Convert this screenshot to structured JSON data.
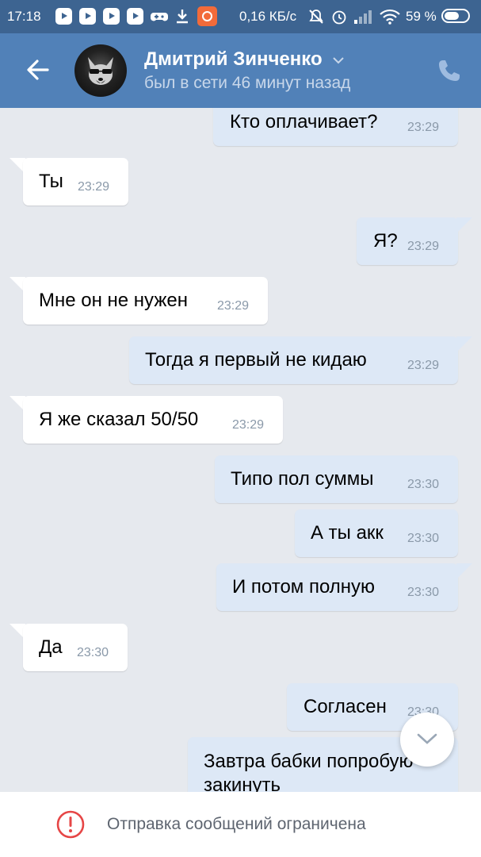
{
  "status_bar": {
    "time": "17:18",
    "network_speed": "0,16 КБ/с",
    "battery": "59 %",
    "icons": [
      "youtube-icon",
      "youtube-icon",
      "youtube-icon",
      "youtube-icon",
      "gamepad-icon",
      "download-icon",
      "app-notification-icon",
      "mute-icon",
      "alarm-icon",
      "signal-icon",
      "wifi-icon",
      "battery-icon"
    ]
  },
  "header": {
    "contact_name": "Дмитрий Зинченко",
    "last_seen": "был в сети 46 минут назад",
    "colors": {
      "header": "#5181b8",
      "status_bar": "#3d6491"
    }
  },
  "messages": [
    {
      "direction": "out",
      "text": "Кто оплачивает?",
      "time": "23:29"
    },
    {
      "direction": "in",
      "text": "Ты",
      "time": "23:29"
    },
    {
      "direction": "out",
      "text": "Я?",
      "time": "23:29"
    },
    {
      "direction": "in",
      "text": "Мне он не нужен",
      "time": "23:29"
    },
    {
      "direction": "out",
      "text": "Тогда я первый не кидаю",
      "time": "23:29"
    },
    {
      "direction": "in",
      "text": "Я же сказал 50/50",
      "time": "23:29"
    },
    {
      "direction": "out",
      "text": "Типо пол суммы",
      "time": "23:30"
    },
    {
      "direction": "out",
      "text": "А ты акк",
      "time": "23:30"
    },
    {
      "direction": "out",
      "text": "И потом полную",
      "time": "23:30"
    },
    {
      "direction": "in",
      "text": "Да",
      "time": "23:30"
    },
    {
      "direction": "out",
      "text": "Согласен",
      "time": "23:30"
    },
    {
      "direction": "out",
      "text": "Завтра бабки попробую закинуть",
      "time": ""
    }
  ],
  "footer": {
    "restriction_text": "Отправка сообщений ограничена"
  }
}
